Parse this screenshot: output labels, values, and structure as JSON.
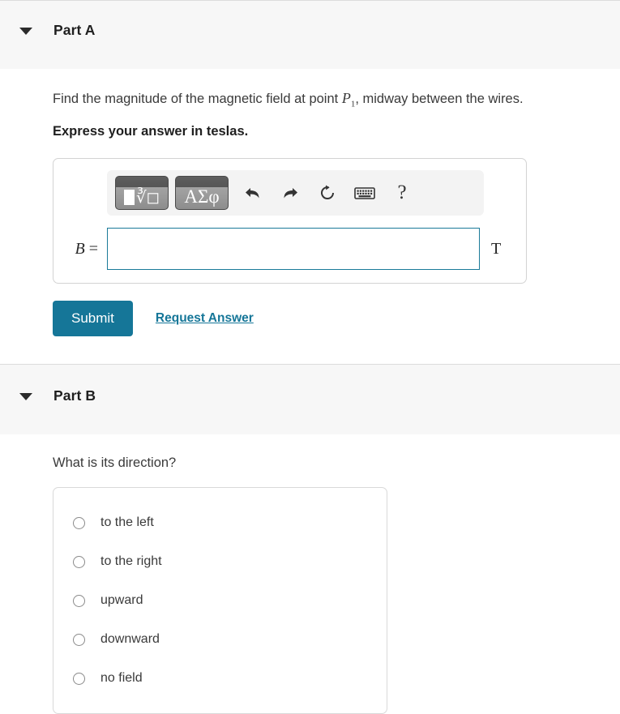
{
  "partA": {
    "title": "Part A",
    "caret_icon": "caret-down-icon",
    "question_pre": "Find the magnitude of the magnetic field at point ",
    "question_var": "P",
    "question_var_sub": "1",
    "question_post": ", midway between the wires.",
    "instruction": "Express your answer in teslas.",
    "toolbar": {
      "template_button": "template-icon",
      "greek_button": "ΑΣφ",
      "undo": "undo-icon",
      "redo": "redo-icon",
      "reset": "reset-icon",
      "keyboard": "keyboard-icon",
      "help": "?"
    },
    "input": {
      "variable": "B",
      "equals": "=",
      "value": "",
      "placeholder": "",
      "unit": "T"
    },
    "submit_label": "Submit",
    "request_answer_label": "Request Answer"
  },
  "partB": {
    "title": "Part B",
    "caret_icon": "caret-down-icon",
    "question": "What is its direction?",
    "options": [
      {
        "label": "to the left",
        "selected": false
      },
      {
        "label": "to the right",
        "selected": false
      },
      {
        "label": "upward",
        "selected": false
      },
      {
        "label": "downward",
        "selected": false
      },
      {
        "label": "no field",
        "selected": false
      }
    ]
  },
  "colors": {
    "accent": "#157698",
    "input_border": "#1a7a99",
    "header_bg": "#f7f7f7",
    "text": "#3a3a3a"
  }
}
